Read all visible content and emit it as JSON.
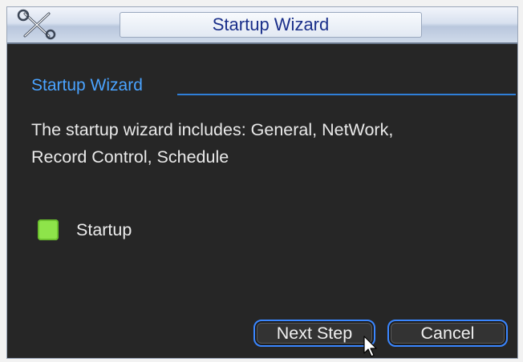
{
  "window": {
    "title": "Startup Wizard"
  },
  "icons": {
    "titlebar": "wrench-screwdriver-icon",
    "pointer": "mouse-cursor-icon"
  },
  "section": {
    "title": "Startup Wizard"
  },
  "description": {
    "line1": "The startup wizard includes: General, NetWork,",
    "line2": "Record Control, Schedule"
  },
  "startup_option": {
    "label": "Startup",
    "checked": true,
    "color": "#8ee44a"
  },
  "buttons": {
    "next": "Next Step",
    "cancel": "Cancel"
  },
  "colors": {
    "accent": "#3a86ff",
    "section_title": "#4aa3ff",
    "background": "#262626"
  }
}
